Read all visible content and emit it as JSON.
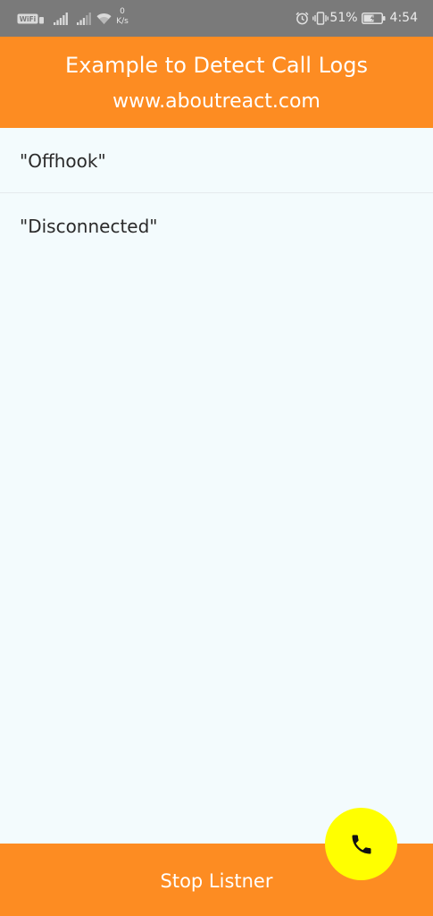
{
  "status_bar": {
    "wifi_badge": "WiFi",
    "net_speed_value": "0",
    "net_speed_unit": "K/s",
    "battery_percent": "51%",
    "time": "4:54",
    "icons": [
      "wifi-badge-icon",
      "signal-icon",
      "signal-icon",
      "wifi-icon",
      "alarm-icon",
      "vibrate-icon",
      "battery-icon"
    ]
  },
  "header": {
    "title": "Example to Detect Call Logs",
    "subtitle": "www.aboutreact.com",
    "background_color": "#fd8c22"
  },
  "call_logs": {
    "items": [
      {
        "label": "\"Offhook\""
      },
      {
        "label": "\"Disconnected\""
      }
    ]
  },
  "bottom_button": {
    "label": "Stop Listner",
    "background_color": "#fd8c22"
  },
  "fab": {
    "icon": "phone-icon",
    "background_color": "#ffff00"
  }
}
